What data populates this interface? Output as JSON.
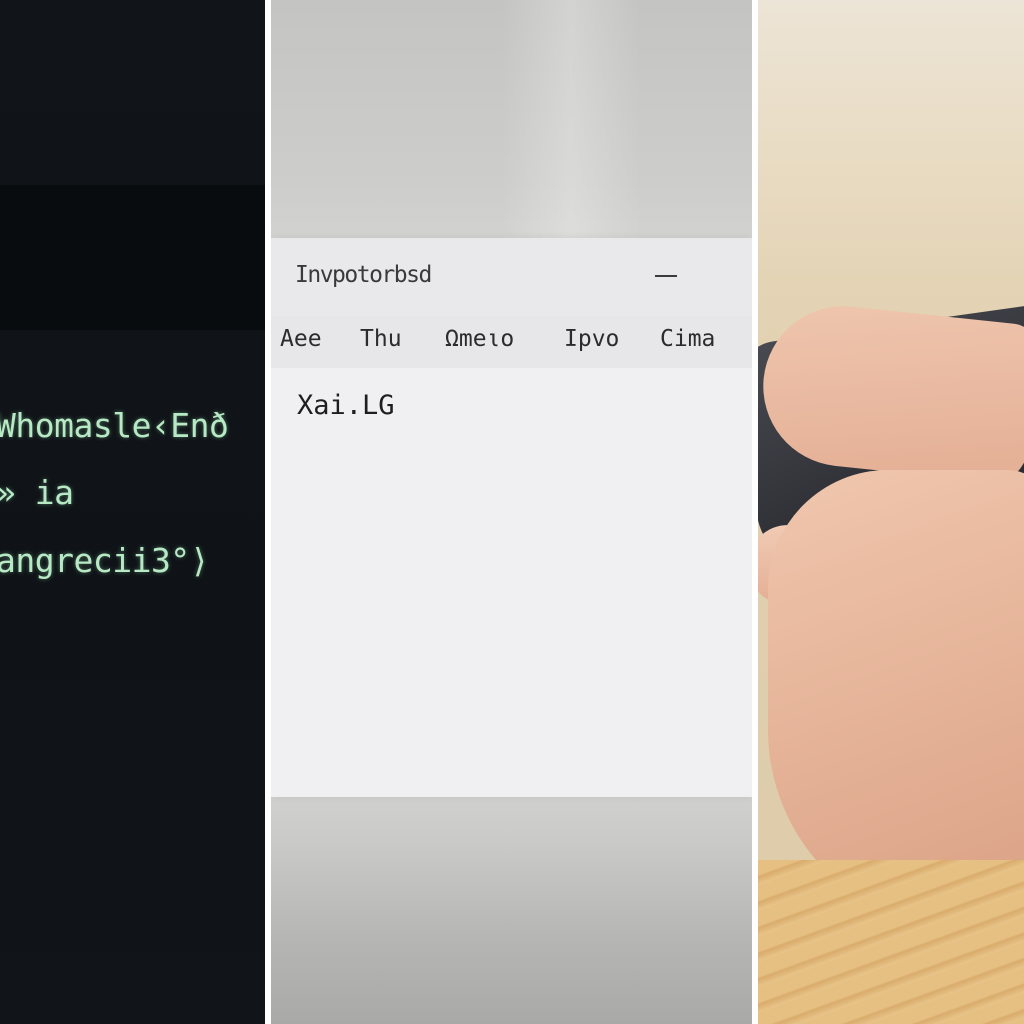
{
  "terminal": {
    "lines": [
      "Whomasle‹Enð",
      "» ia",
      "angrecii3°⟩"
    ],
    "text_color": "#b8e9c5",
    "background": "#111519"
  },
  "editor": {
    "window_title": "Invpotorbsd",
    "menu": [
      "Aee",
      "Thu",
      "Ωmeιo",
      "Ιpvo",
      "Cima"
    ],
    "content": "Xai.LG",
    "background": "#f0f0f2",
    "icons": [
      "minimize-icon"
    ]
  },
  "photo": {
    "description_colors": {
      "skin": "#e4b196",
      "keyboard": "#2f3036",
      "wood": "#e6bf82"
    }
  }
}
